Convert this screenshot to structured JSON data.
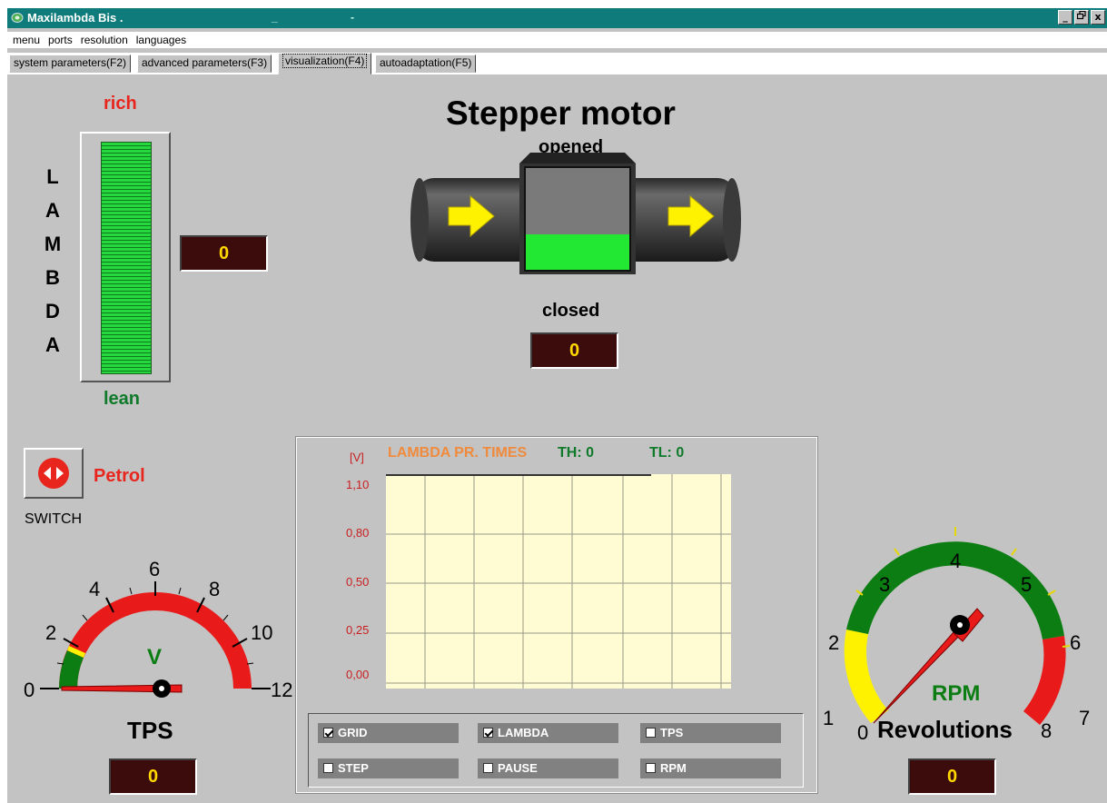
{
  "window": {
    "title": "Maxilambda Bis .",
    "title_dash1": "_",
    "title_dash2": "-",
    "controls": [
      "_",
      "▫",
      "x"
    ]
  },
  "menu": [
    "menu",
    "ports",
    "resolution",
    "languages"
  ],
  "tabs": [
    "system parameters(F2)",
    "advanced parameters(F3)",
    "visualization(F4)",
    "autoadaptation(F5)"
  ],
  "lambda": {
    "letters": "L A M B D A",
    "rich": "rich",
    "lean": "lean",
    "value": "0"
  },
  "stepper": {
    "title": "Stepper motor",
    "opened": "opened",
    "closed": "closed",
    "value": "0"
  },
  "switch": {
    "label": "SWITCH",
    "fuel": "Petrol"
  },
  "tps": {
    "title": "TPS",
    "unit": "V",
    "ticks": [
      "0",
      "2",
      "4",
      "6",
      "8",
      "10",
      "12"
    ],
    "value": "0"
  },
  "rpm": {
    "title": "Revolutions",
    "unit": "RPM",
    "ticks": [
      "0",
      "1",
      "2",
      "3",
      "4",
      "5",
      "6",
      "7",
      "8"
    ],
    "value": "0"
  },
  "chart": {
    "unit": "[V]",
    "title": "LAMBDA PR. TIMES",
    "th": "TH: 0",
    "tl": "TL: 0",
    "yticks": [
      "1,10",
      "0,80",
      "0,50",
      "0,25",
      "0,00"
    ]
  },
  "checkboxes": [
    {
      "label": "GRID",
      "checked": true
    },
    {
      "label": "LAMBDA",
      "checked": true
    },
    {
      "label": "TPS",
      "checked": false
    },
    {
      "label": "STEP",
      "checked": false
    },
    {
      "label": "PAUSE",
      "checked": false
    },
    {
      "label": "RPM",
      "checked": false
    }
  ],
  "colors": {
    "lcd_bg": "#3c0c0c",
    "lcd_text": "#ffd800",
    "rich": "#e8261d",
    "lean": "#0e7a2a",
    "gauge_green": "#0b7d12",
    "gauge_yellow": "#fff200",
    "gauge_red": "#e81a1a",
    "chart_bg": "#fffbd2"
  }
}
